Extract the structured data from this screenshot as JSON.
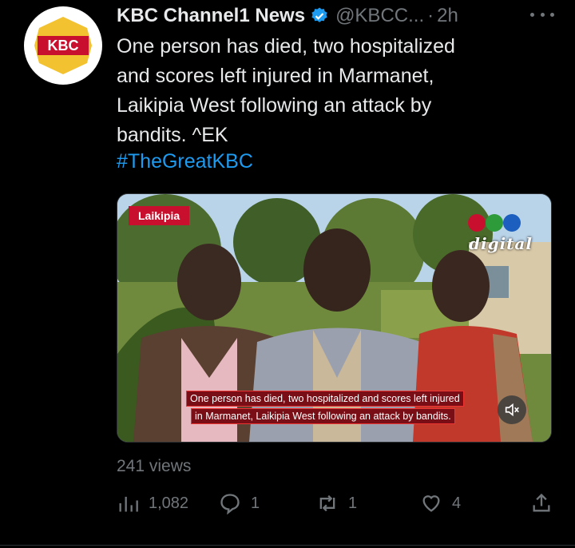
{
  "tweet": {
    "author_name": "KBC Channel1 News",
    "handle": "@KBCC...",
    "separator": "·",
    "time": "2h",
    "text": "One person has died, two hospitalized\nand scores left injured in Marmanet,\nLaikipia West following an attack by\nbandits. ^EK",
    "hashtag": "#TheGreatKBC",
    "avatar_text": "KBC"
  },
  "media": {
    "location_tag": "Laikipia",
    "watermark": "digital",
    "caption_line1": "One person has died, two hospitalized and scores left injured",
    "caption_line2": "in Marmanet, Laikipia West following an attack by bandits."
  },
  "stats": {
    "views": "241 views",
    "analytics_count": "1,082",
    "reply_count": "1",
    "retweet_count": "1",
    "like_count": "4"
  },
  "icons": [
    "verified-icon",
    "more-icon",
    "analytics-icon",
    "reply-icon",
    "retweet-icon",
    "like-icon",
    "share-icon",
    "mute-icon"
  ],
  "colors": {
    "background": "#000000",
    "link": "#1d9bf0",
    "muted": "#71767b",
    "brand_red": "#c8102e"
  }
}
